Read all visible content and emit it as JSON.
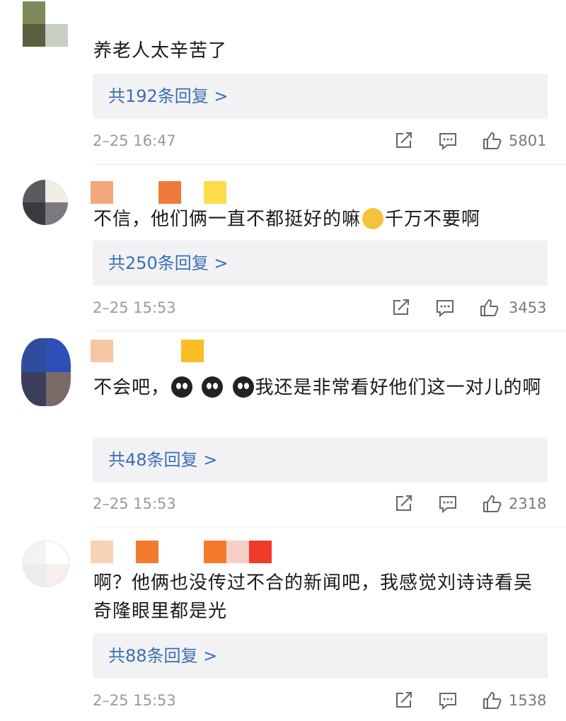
{
  "comments": [
    {
      "text": "养老人太辛苦了",
      "replies": "共192条回复 >",
      "time": "2–25 16:47",
      "likes": "5801",
      "avatar_colors": [
        "#7d8a5a",
        "#ffffff",
        "#5b5f3d",
        "#c7cfc2"
      ],
      "name_colors": []
    },
    {
      "text_a": "不信，他们俩一直不都挺好的嘛",
      "text_b": "千万不要啊",
      "replies": "共250条回复 >",
      "time": "2–25 15:53",
      "likes": "3453",
      "avatar_colors": [
        "#5a5a60",
        "#f0ece6",
        "#3a3a40",
        "#7a7a80"
      ],
      "name_colors": [
        "#f3a87c",
        "#ffffff",
        "#ffffff",
        "#f07a3c",
        "#ffffff",
        "#fddc4c"
      ]
    },
    {
      "text_a": "不会吧，",
      "text_b": "我还是非常看好他们这一对儿的啊",
      "replies": "共48条回复 >",
      "time": "2–25 15:53",
      "likes": "2318",
      "avatar_colors": [
        "#2f4d9e",
        "#2c4fb8",
        "#3b3f5a",
        "#7a6a68"
      ],
      "name_colors": [
        "#f6c6a4",
        "#ffffff",
        "#ffffff",
        "#ffffff",
        "#fbbd26"
      ]
    },
    {
      "text": "啊？他俩也没传过不合的新闻吧，我感觉刘诗诗看吴奇隆眼里都是光",
      "replies": "共88条回复 >",
      "time": "2–25 15:53",
      "likes": "1538",
      "avatar_colors": [
        "#f3f3f3",
        "#ffffff",
        "#ececec",
        "#f8eeee"
      ],
      "name_colors": [
        "#f8d2b8",
        "#ffffff",
        "#f47a2e",
        "#ffffff",
        "#ffffff",
        "#f47a2e",
        "#f8d0c8",
        "#ef3a2c"
      ]
    }
  ],
  "icons": {
    "share": "share-icon",
    "reply": "comment-icon",
    "like": "thumbs-up-icon"
  }
}
